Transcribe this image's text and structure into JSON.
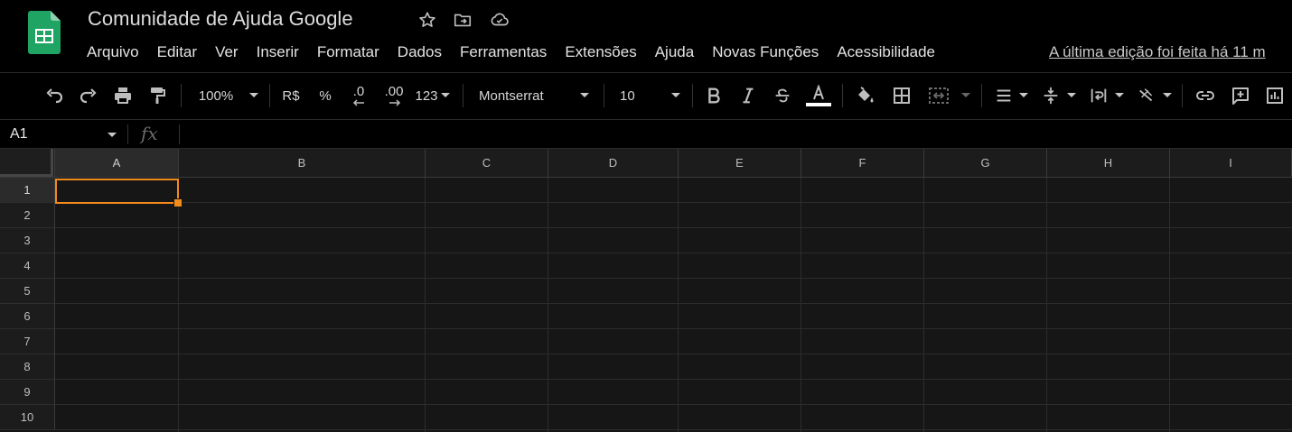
{
  "app": {
    "title": "Comunidade de Ajuda Google",
    "logo_icon": "google-sheets-logo",
    "logo_color": "#1fa463",
    "header_icons": [
      "star-icon",
      "move-to-folder-icon",
      "cloud-saved-icon"
    ]
  },
  "menu": {
    "items": [
      "Arquivo",
      "Editar",
      "Ver",
      "Inserir",
      "Formatar",
      "Dados",
      "Ferramentas",
      "Extensões",
      "Ajuda",
      "Novas Funções",
      "Acessibilidade"
    ],
    "last_edit": "A última edição foi feita há 11 m"
  },
  "toolbar": {
    "zoom": "100%",
    "currency": "R$",
    "percent": "%",
    "decrease_decimal": ".0",
    "increase_decimal": ".00",
    "more_formats": "123",
    "font": "Montserrat",
    "font_size": "10",
    "text_color_swatch": "#ffffff"
  },
  "formula_bar": {
    "name_box": "A1",
    "fx": "fx",
    "value": ""
  },
  "grid": {
    "columns": [
      "A",
      "B",
      "C",
      "D",
      "E",
      "F",
      "G",
      "H",
      "I"
    ],
    "rows": [
      "1",
      "2",
      "3",
      "4",
      "5",
      "6",
      "7",
      "8",
      "9",
      "10"
    ],
    "active_cell": "A1",
    "selection_color": "#f28b1c"
  }
}
